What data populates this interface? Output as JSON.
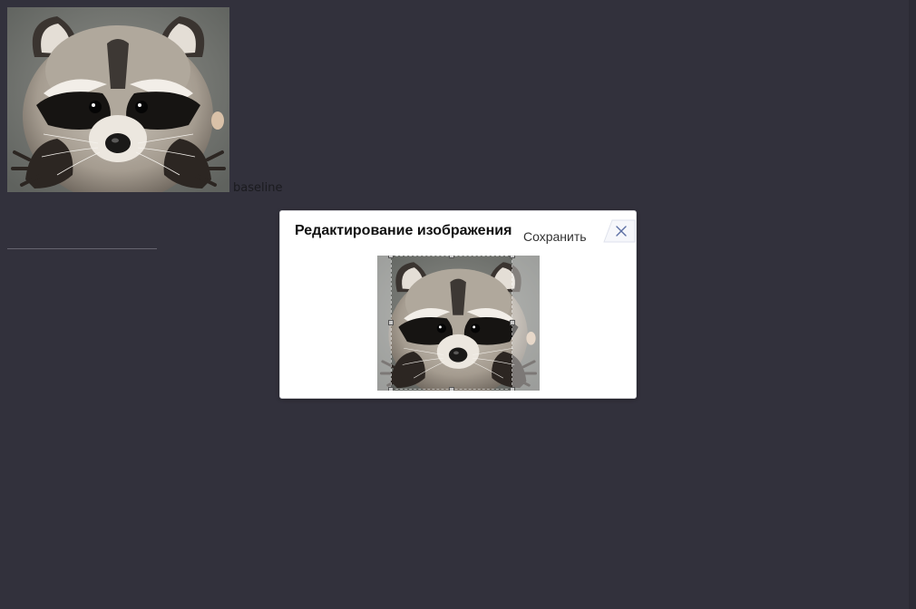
{
  "page": {
    "image_alt": "raccoon",
    "baseline_label": "baseline"
  },
  "dialog": {
    "title": "Редактирование изображения",
    "save_label": "Сохранить",
    "close_icon": "close-icon",
    "crop_image_alt": "raccoon"
  },
  "colors": {
    "background": "#32313c",
    "dialog_background": "#ffffff",
    "close_icon": "#5b6ea3"
  }
}
